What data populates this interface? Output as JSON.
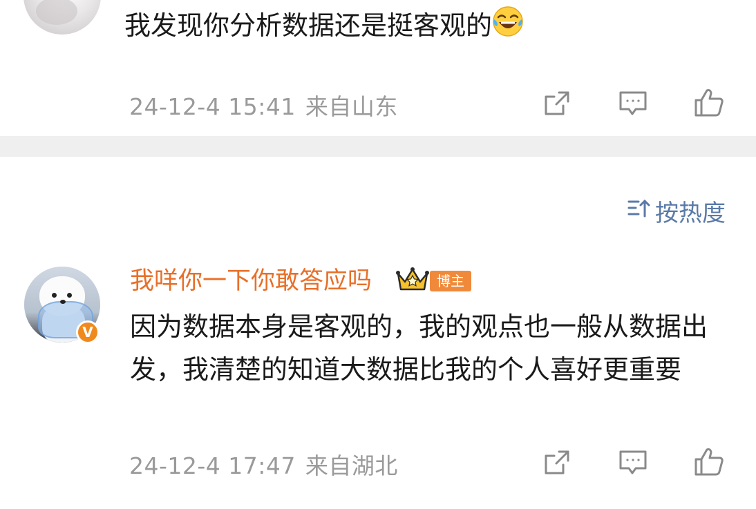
{
  "comment1": {
    "text": "我发现你分析数据还是挺客观的",
    "emoji": "laughing-tears-emoji",
    "time": "24-12-4 15:41",
    "location": "来自山东"
  },
  "sort": {
    "label": "按热度",
    "icon": "sort-icon"
  },
  "comment2": {
    "username": "我咩你一下你敢答应吗",
    "role_badge": "博主",
    "verified_badge": "V",
    "text": "因为数据本身是客观的，我的观点也一般从数据出发，我清楚的知道大数据比我的个人喜好更重要",
    "time": "24-12-4 17:47",
    "location": "来自湖北"
  },
  "actions": {
    "icons": [
      "share-icon",
      "comment-icon",
      "like-icon"
    ]
  },
  "colors": {
    "username": "#e86f28",
    "meta": "#9a9a9a",
    "sort": "#5a7aa8",
    "separator": "#efefef",
    "badge": "#f08a3a"
  }
}
